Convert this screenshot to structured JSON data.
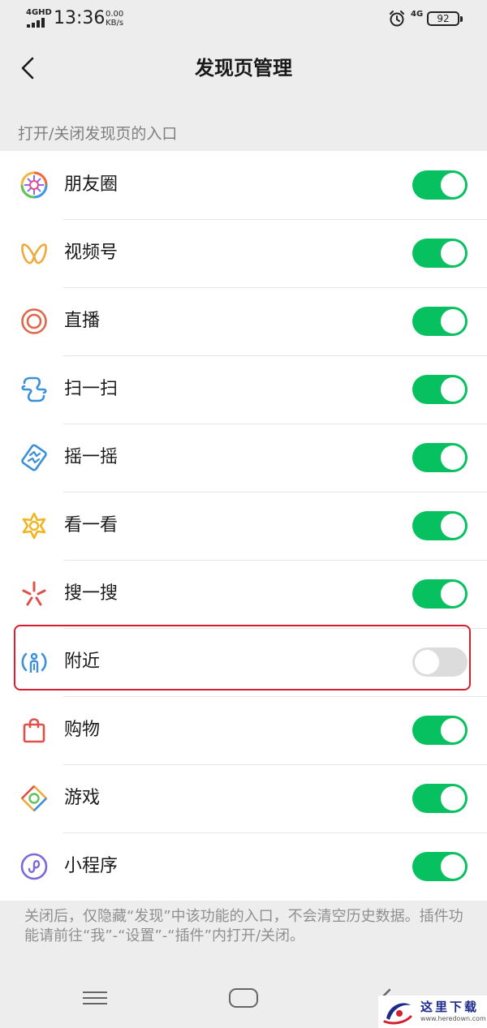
{
  "status_bar": {
    "network_label": "4GHD",
    "time": "13:36",
    "speed_value": "0.00",
    "speed_unit": "KB/s",
    "signal_4g": "4G",
    "battery": "92"
  },
  "header": {
    "title": "发现页管理"
  },
  "section": {
    "header": "打开/关闭发现页的入口"
  },
  "items": [
    {
      "label": "朋友圈",
      "icon": "moments-icon",
      "enabled": true
    },
    {
      "label": "视频号",
      "icon": "channels-icon",
      "enabled": true
    },
    {
      "label": "直播",
      "icon": "live-icon",
      "enabled": true
    },
    {
      "label": "扫一扫",
      "icon": "scan-icon",
      "enabled": true
    },
    {
      "label": "摇一摇",
      "icon": "shake-icon",
      "enabled": true
    },
    {
      "label": "看一看",
      "icon": "top-stories-icon",
      "enabled": true
    },
    {
      "label": "搜一搜",
      "icon": "search-icon",
      "enabled": true
    },
    {
      "label": "附近",
      "icon": "nearby-icon",
      "enabled": false
    },
    {
      "label": "购物",
      "icon": "shopping-icon",
      "enabled": true
    },
    {
      "label": "游戏",
      "icon": "games-icon",
      "enabled": true
    },
    {
      "label": "小程序",
      "icon": "mini-programs-icon",
      "enabled": true
    }
  ],
  "footnote": "关闭后，仅隐藏“发现”中该功能的入口，不会清空历史数据。插件功能请前往“我”-“设置”-“插件”内打开/关闭。",
  "watermark": {
    "title": "这里下载",
    "url": "www.heredown.com"
  },
  "colors": {
    "toggle_on": "#07c160",
    "toggle_off": "#dcdcdc",
    "highlight": "#d51f2e",
    "background": "#ededed"
  }
}
